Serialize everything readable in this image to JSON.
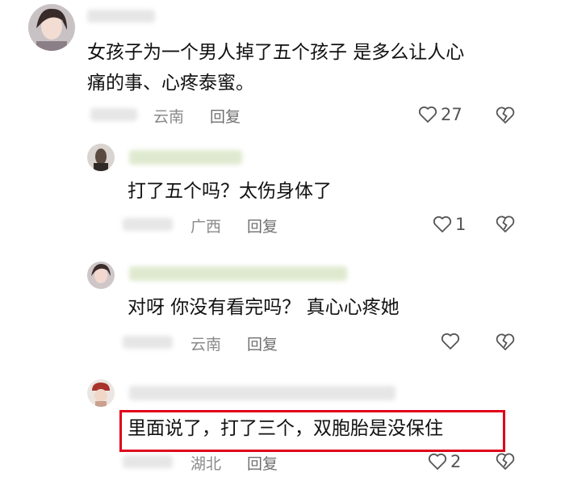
{
  "comments": [
    {
      "text_line1": "女孩子为一个男人掉了五个孩子 是多么让人心",
      "text_line2": "痛的事、心疼泰蜜。",
      "location": "云南",
      "reply_label": "回复",
      "likes": "27"
    },
    {
      "text": "打了五个吗？太伤身体了",
      "location": "广西",
      "reply_label": "回复",
      "likes": "1"
    },
    {
      "text": "对呀 你没有看完吗？ 真心心疼她",
      "location": "云南",
      "reply_label": "回复",
      "likes": ""
    },
    {
      "text": "里面说了，打了三个，双胞胎是没保住",
      "location": "湖北",
      "reply_label": "回复",
      "likes": "2"
    }
  ],
  "colors": {
    "highlight_border": "#e0001a",
    "meta_text": "#8a8a8a"
  },
  "icons": [
    "heart-outline-icon",
    "broken-heart-icon"
  ]
}
